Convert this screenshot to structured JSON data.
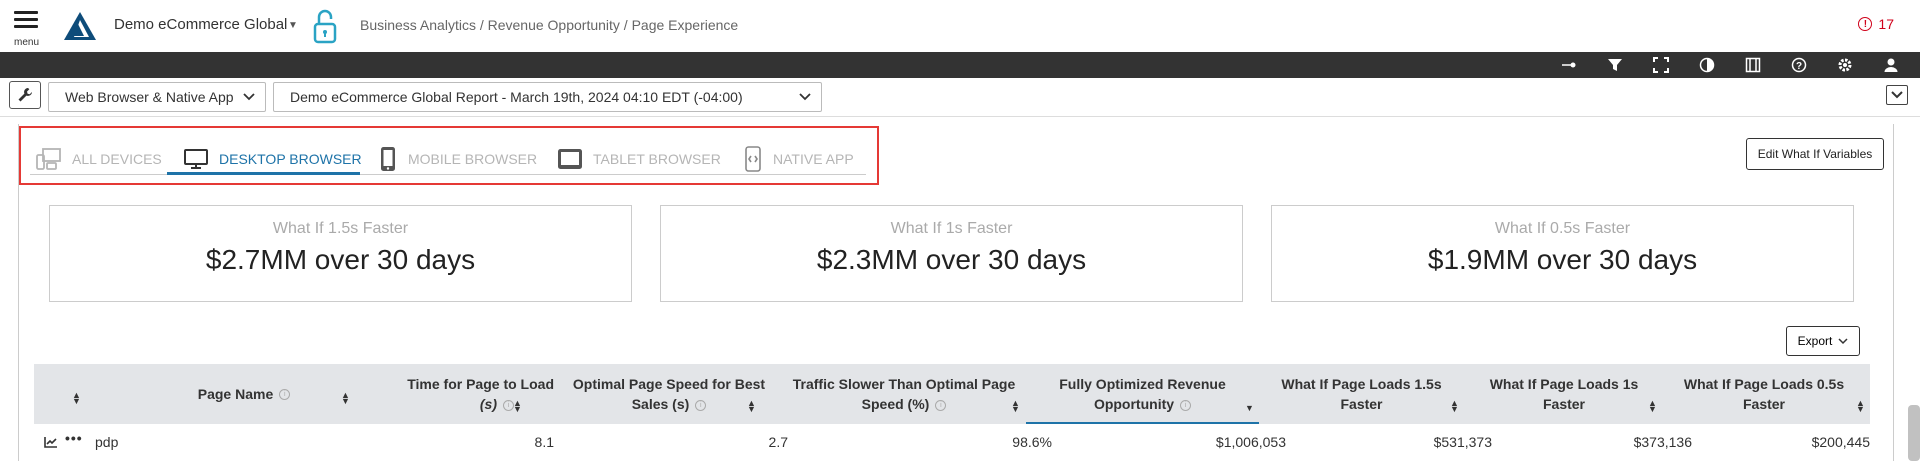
{
  "header": {
    "menu_label": "menu",
    "org_name": "Demo eCommerce Global",
    "breadcrumb": "Business Analytics / Revenue Opportunity / Page Experience",
    "alert_count": "17"
  },
  "toolbar": {
    "icons": [
      "pin-icon",
      "filter-icon",
      "fullscreen-icon",
      "contrast-icon",
      "video-icon",
      "help-icon",
      "settings-icon",
      "user-icon"
    ]
  },
  "filters": {
    "platform": "Web Browser & Native App",
    "report": "Demo eCommerce Global Report - March 19th, 2024 04:10 EDT (-04:00)"
  },
  "tabs": [
    {
      "label": "ALL DEVICES",
      "active": false
    },
    {
      "label": "DESKTOP BROWSER",
      "active": true
    },
    {
      "label": "MOBILE BROWSER",
      "active": false
    },
    {
      "label": "TABLET BROWSER",
      "active": false
    },
    {
      "label": "NATIVE APP",
      "active": false
    }
  ],
  "edit_button": "Edit What If Variables",
  "cards": [
    {
      "title": "What If 1.5s Faster",
      "value": "$2.7MM over 30 days"
    },
    {
      "title": "What If 1s Faster",
      "value": "$2.3MM over 30 days"
    },
    {
      "title": "What If 0.5s Faster",
      "value": "$1.9MM over 30 days"
    }
  ],
  "export_button": "Export",
  "table": {
    "columns": [
      {
        "line1": "Page Name",
        "line2": ""
      },
      {
        "line1": "Time for Page to Load",
        "line2": "(s)"
      },
      {
        "line1": "Optimal Page Speed for Best",
        "line2": "Sales (s)"
      },
      {
        "line1": "Traffic Slower Than Optimal Page",
        "line2": "Speed (%)"
      },
      {
        "line1": "Fully Optimized Revenue",
        "line2": "Opportunity"
      },
      {
        "line1": "What If Page Loads 1.5s",
        "line2": "Faster"
      },
      {
        "line1": "What If Page Loads 1s",
        "line2": "Faster"
      },
      {
        "line1": "What If Page Loads 0.5s",
        "line2": "Faster"
      }
    ],
    "rows": [
      {
        "page": "pdp",
        "load": "8.1",
        "optimal": "2.7",
        "slower": "98.6%",
        "revenue": "$1,006,053",
        "w15": "$531,373",
        "w1": "$373,136",
        "w05": "$200,445"
      }
    ]
  }
}
